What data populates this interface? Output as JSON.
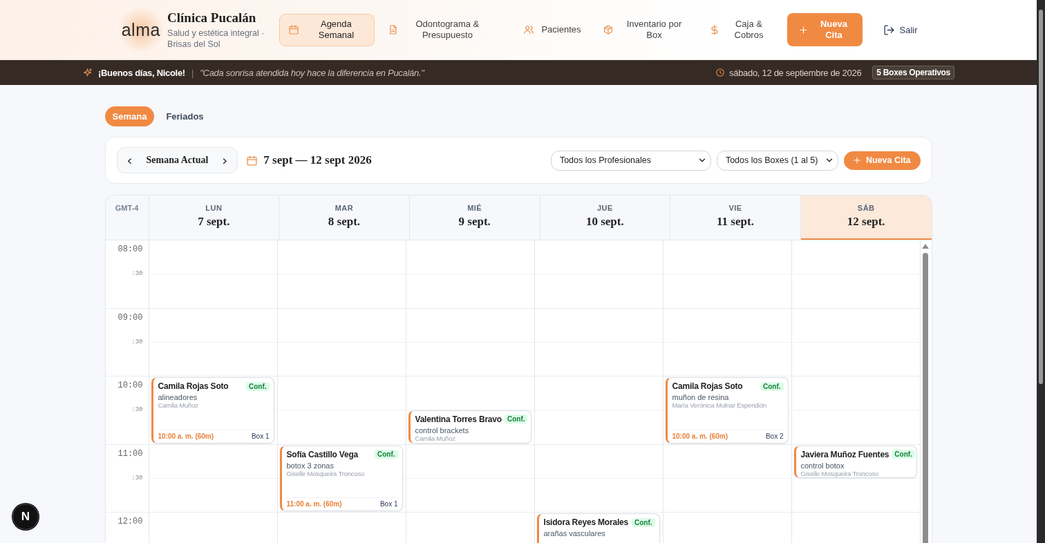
{
  "header": {
    "logo": "alma",
    "clinic_name": "Clínica Pucalán",
    "tagline": "Salud y estética integral · Brisas del Sol",
    "nav": [
      {
        "label": "Agenda Semanal",
        "kind": "calendar",
        "selected": true
      },
      {
        "label": "Odontograma & Presupuesto",
        "kind": "document",
        "selected": false
      },
      {
        "label": "Pacientes",
        "kind": "users",
        "selected": false
      },
      {
        "label": "Inventario por Box",
        "kind": "box",
        "selected": false
      },
      {
        "label": "Caja & Cobros",
        "kind": "dollar",
        "selected": false
      }
    ],
    "new_button": "Nueva Cita",
    "logout": "Salir"
  },
  "greeting_bar": {
    "greeting": "¡Buenos días, Nicole!",
    "separator": "|",
    "quote": "\"Cada sonrisa atendida hoy hace la diferencia en Pucalán.\"",
    "date": "sábado, 12 de septiembre de 2026",
    "boxes_badge": "5 Boxes Operativos"
  },
  "view_tabs": [
    {
      "label": "Semana",
      "selected": true
    },
    {
      "label": "Feriados",
      "selected": false
    }
  ],
  "toolbar": {
    "prev": "‹",
    "week_label": "Semana Actual",
    "next": "›",
    "range": "7 sept — 12 sept 2026",
    "professional_filter": "Todos los Profesionales",
    "box_filter": "Todos los Boxes (1 al 5)",
    "new_button": "Nueva Cita"
  },
  "calendar": {
    "timezone": "GMT-4",
    "days": [
      {
        "weekday": "LUN",
        "date": "7 sept.",
        "selected": false
      },
      {
        "weekday": "MAR",
        "date": "8 sept.",
        "selected": false
      },
      {
        "weekday": "MIÉ",
        "date": "9 sept.",
        "selected": false
      },
      {
        "weekday": "JUE",
        "date": "10 sept.",
        "selected": false
      },
      {
        "weekday": "VIE",
        "date": "11 sept.",
        "selected": false
      },
      {
        "weekday": "SÁB",
        "date": "12 sept.",
        "selected": true
      }
    ],
    "hours": [
      {
        "label": "08:00",
        "half_label": ":30",
        "cells": [
          {
            "kind": "empty"
          },
          {
            "kind": "empty"
          },
          {
            "kind": "empty"
          },
          {
            "kind": "empty"
          },
          {
            "kind": "empty"
          },
          {
            "kind": "empty"
          }
        ]
      },
      {
        "label": "09:00",
        "half_label": ":30",
        "cells": [
          {
            "kind": "empty"
          },
          {
            "kind": "empty"
          },
          {
            "kind": "empty"
          },
          {
            "kind": "empty"
          },
          {
            "kind": "empty"
          },
          {
            "kind": "empty"
          }
        ]
      },
      {
        "label": "10:00",
        "half_label": ":30",
        "cells": [
          {
            "kind": "full",
            "name": "Camila Rojas Soto",
            "status": "Conf.",
            "service": "alineadores",
            "professional": "Camila Muñoz",
            "time": "10:00 a. m. (60m)",
            "box": "Box 1"
          },
          {
            "kind": "empty"
          },
          {
            "kind": "second_half",
            "name": "Valentina Torres Bravo",
            "status": "Conf.",
            "service": "control brackets",
            "professional": "Camila Muñoz"
          },
          {
            "kind": "empty"
          },
          {
            "kind": "full",
            "name": "Camila Rojas Soto",
            "status": "Conf.",
            "service": "muñon de resina",
            "professional": "María Verónica Molnar Esperidión",
            "time": "10:00 a. m. (60m)",
            "box": "Box 2"
          },
          {
            "kind": "empty"
          }
        ]
      },
      {
        "label": "11:00",
        "half_label": ":30",
        "cells": [
          {
            "kind": "empty"
          },
          {
            "kind": "full",
            "name": "Sofía Castillo Vega",
            "status": "Conf.",
            "service": "botox 3 zonas",
            "professional": "Giselle Mosqueira Troncoso",
            "time": "11:00 a. m. (60m)",
            "box": "Box 1"
          },
          {
            "kind": "empty"
          },
          {
            "kind": "empty"
          },
          {
            "kind": "empty"
          },
          {
            "kind": "first_half",
            "name": "Javiera Muñoz Fuentes",
            "status": "Conf.",
            "service": "control botox",
            "professional": "Giselle Mosqueira Troncoso"
          }
        ]
      },
      {
        "label": "12:00",
        "cells": [
          {
            "kind": "empty"
          },
          {
            "kind": "empty"
          },
          {
            "kind": "empty"
          },
          {
            "kind": "full",
            "name": "Isidora Reyes Morales",
            "status": "Conf.",
            "service": "arañas vasculares"
          },
          {
            "kind": "empty"
          },
          {
            "kind": "empty"
          }
        ]
      }
    ]
  },
  "dev_badge": "N"
}
